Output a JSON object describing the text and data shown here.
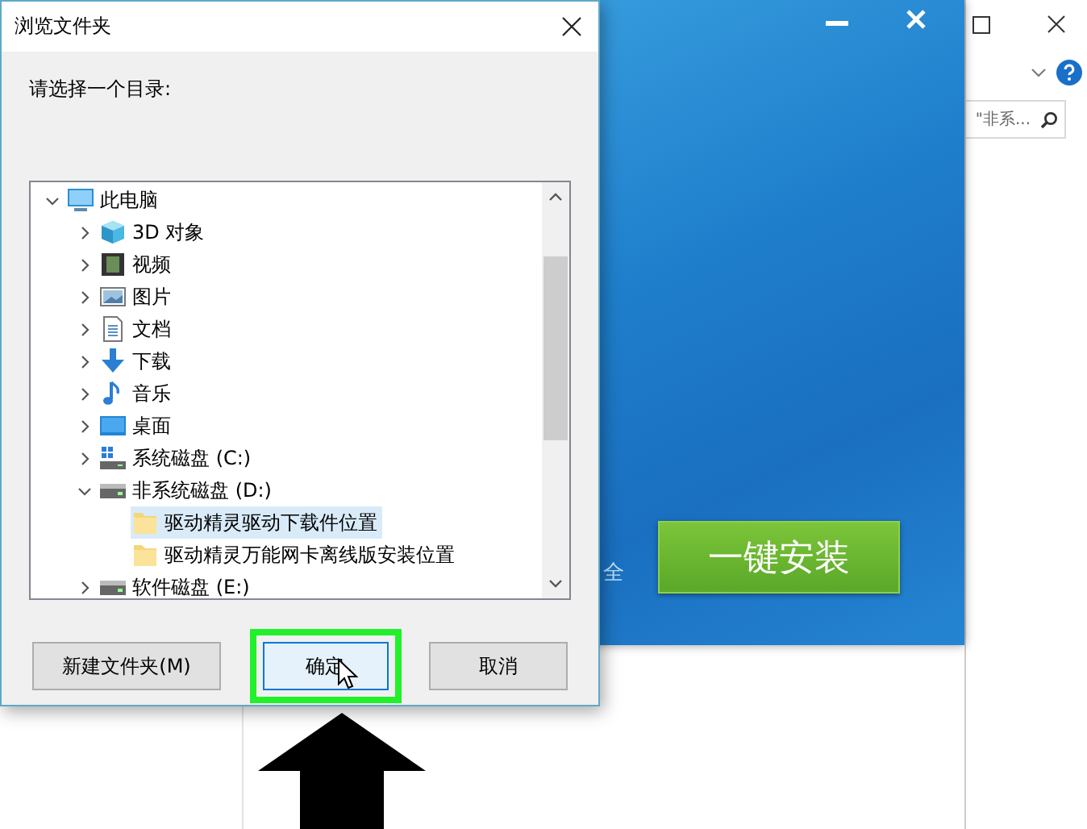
{
  "explorer": {
    "search_placeholder": "\"非系..."
  },
  "installer": {
    "side_text": "全",
    "install_button": "一键安装"
  },
  "dialog": {
    "title": "浏览文件夹",
    "prompt": "请选择一个目录:",
    "tree": [
      {
        "label": "此电脑",
        "kind": "computer",
        "expandable": true,
        "expanded": true,
        "selected": false,
        "children": [
          {
            "label": "3D 对象",
            "kind": "cube",
            "expandable": true,
            "expanded": false,
            "selected": false
          },
          {
            "label": "视频",
            "kind": "film",
            "expandable": true,
            "expanded": false,
            "selected": false
          },
          {
            "label": "图片",
            "kind": "picture",
            "expandable": true,
            "expanded": false,
            "selected": false
          },
          {
            "label": "文档",
            "kind": "document",
            "expandable": true,
            "expanded": false,
            "selected": false
          },
          {
            "label": "下载",
            "kind": "download",
            "expandable": true,
            "expanded": false,
            "selected": false
          },
          {
            "label": "音乐",
            "kind": "music",
            "expandable": true,
            "expanded": false,
            "selected": false
          },
          {
            "label": "桌面",
            "kind": "desktop",
            "expandable": true,
            "expanded": false,
            "selected": false
          },
          {
            "label": "系统磁盘 (C:)",
            "kind": "system-drive",
            "expandable": true,
            "expanded": false,
            "selected": false
          },
          {
            "label": "非系统磁盘 (D:)",
            "kind": "drive",
            "expandable": true,
            "expanded": true,
            "selected": false,
            "children": [
              {
                "label": "驱动精灵驱动下载件位置",
                "kind": "folder",
                "expandable": false,
                "selected": true
              },
              {
                "label": "驱动精灵万能网卡离线版安装位置",
                "kind": "folder",
                "expandable": false,
                "selected": false
              }
            ]
          },
          {
            "label": "软件磁盘 (E:)",
            "kind": "drive",
            "expandable": true,
            "expanded": false,
            "selected": false
          }
        ]
      }
    ],
    "buttons": [
      {
        "label": "新建文件夹(M)",
        "hovered": false,
        "highlighted": false
      },
      {
        "label": "确定",
        "hovered": true,
        "highlighted": true
      },
      {
        "label": "取消",
        "hovered": false,
        "highlighted": false
      }
    ]
  }
}
